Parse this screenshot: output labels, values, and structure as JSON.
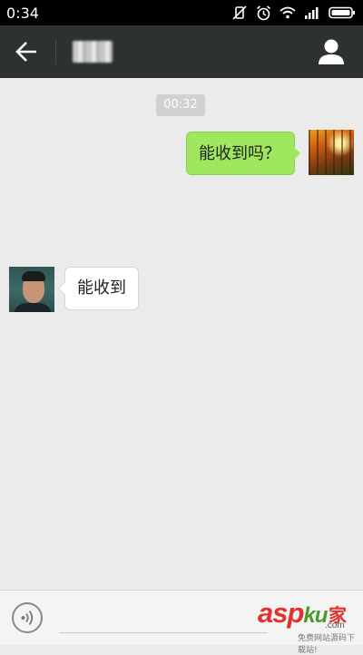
{
  "status_bar": {
    "time": "0:34",
    "icons": [
      "vibrate-off-icon",
      "alarm-icon",
      "wifi-icon",
      "signal-icon",
      "battery-icon"
    ]
  },
  "title_bar": {
    "contact_name": "",
    "back_icon": "arrow-left-icon",
    "profile_icon": "person-icon",
    "background_color": "#2e3132"
  },
  "chat": {
    "timestamp": "00:32",
    "messages": [
      {
        "side": "outgoing",
        "text": "能收到吗？",
        "bubble_color": "#9fe75e"
      },
      {
        "side": "incoming",
        "text": "能收到",
        "bubble_color": "#ffffff"
      }
    ]
  },
  "input_bar": {
    "voice_icon": "voice-input-icon",
    "input_value": "",
    "placeholder": ""
  },
  "watermark": {
    "logo_text": "asp",
    "logo_suffix": "ku",
    "home_text": "家",
    "domain": ".com",
    "slogan": "免费网站源码下载站!"
  }
}
